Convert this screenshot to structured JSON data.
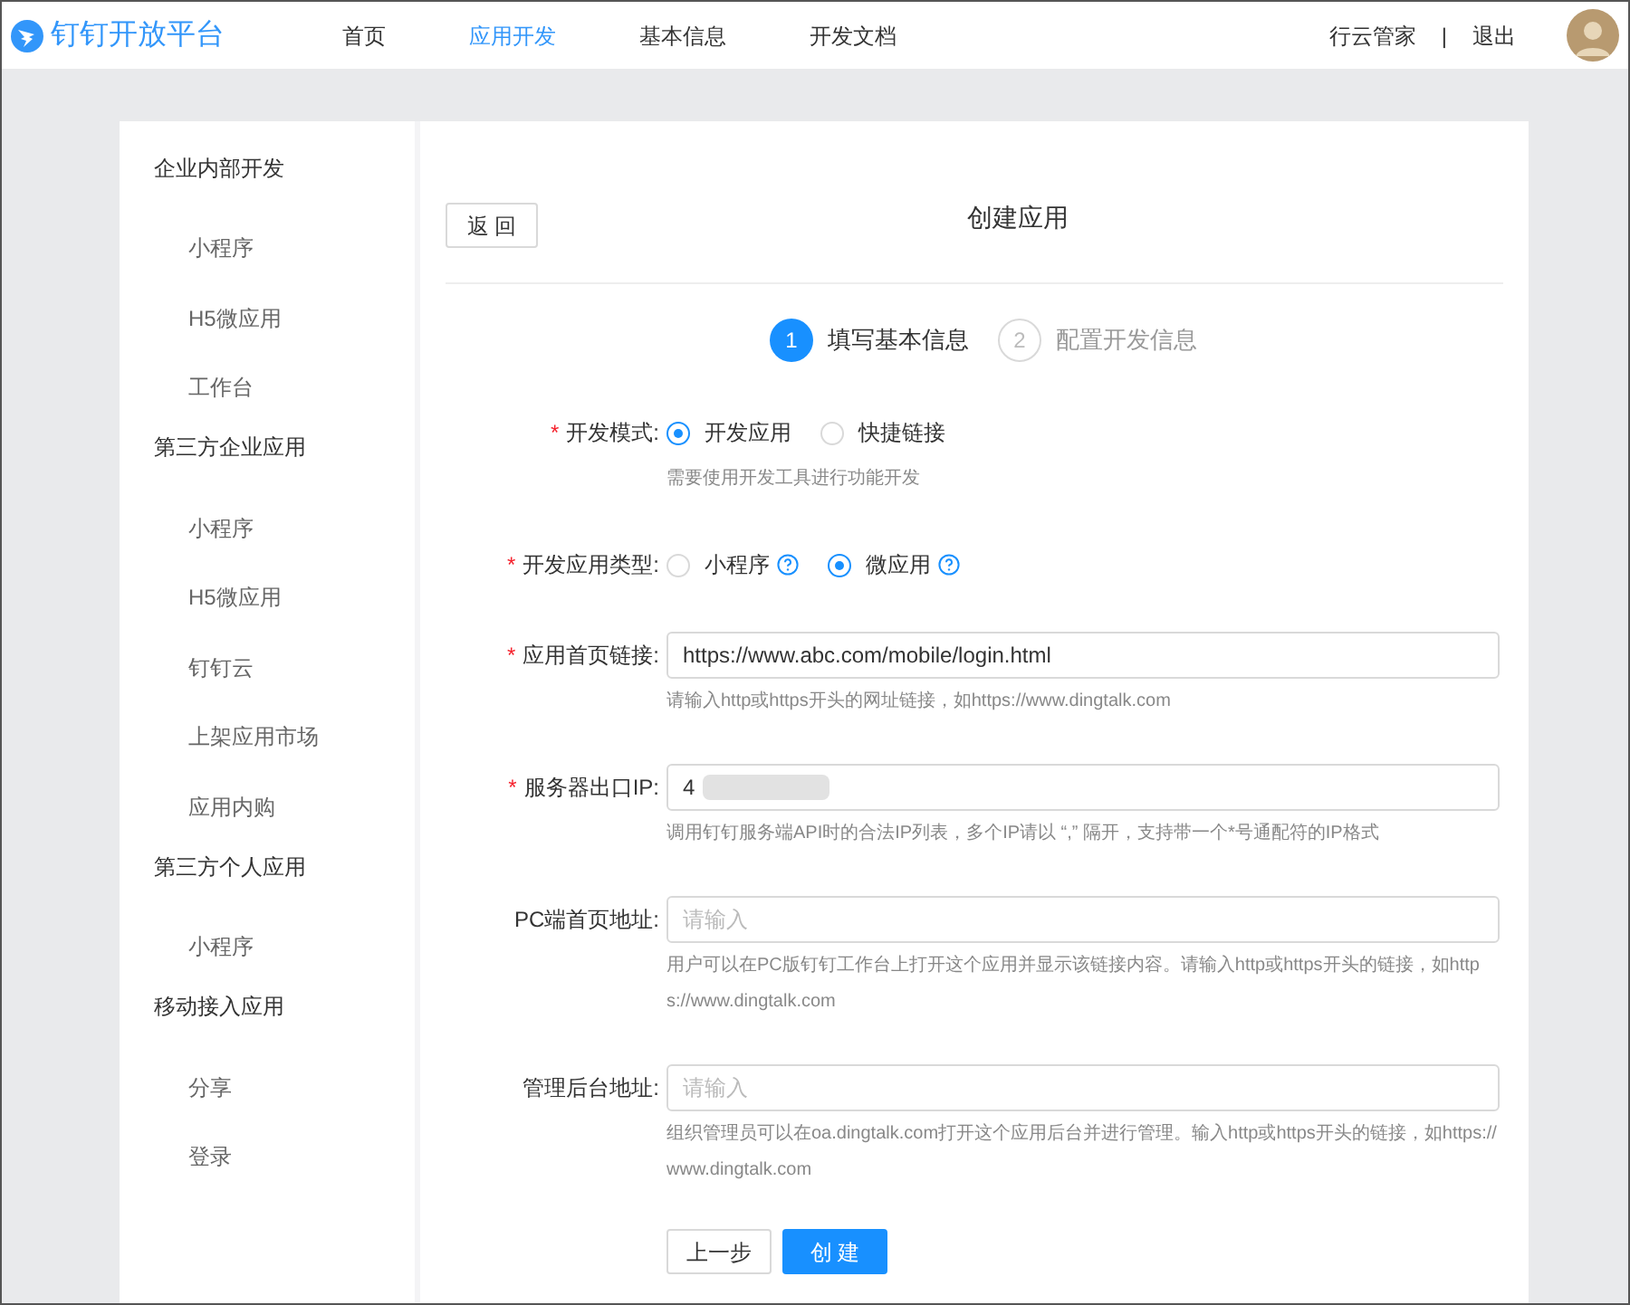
{
  "header": {
    "logo": "钉钉开放平台",
    "nav": [
      {
        "label": "首页",
        "selected": false
      },
      {
        "label": "应用开发",
        "selected": true
      },
      {
        "label": "基本信息",
        "selected": false
      },
      {
        "label": "开发文档",
        "selected": false
      }
    ],
    "user": "行云管家",
    "separator": "|",
    "logout": "退出"
  },
  "sidebar": {
    "groups": [
      {
        "title": "企业内部开发",
        "items": [
          {
            "label": "小程序"
          },
          {
            "label": "H5微应用"
          },
          {
            "label": "工作台"
          }
        ]
      },
      {
        "title": "第三方企业应用",
        "items": [
          {
            "label": "小程序"
          },
          {
            "label": "H5微应用"
          },
          {
            "label": "钉钉云"
          },
          {
            "label": "上架应用市场"
          },
          {
            "label": "应用内购"
          }
        ]
      },
      {
        "title": "第三方个人应用",
        "items": [
          {
            "label": "小程序"
          }
        ]
      },
      {
        "title": "移动接入应用",
        "items": [
          {
            "label": "分享"
          },
          {
            "label": "登录"
          }
        ]
      }
    ]
  },
  "main": {
    "back_button": "返 回",
    "title": "创建应用",
    "steps": [
      {
        "number": "1",
        "label": "填写基本信息",
        "selected": true
      },
      {
        "number": "2",
        "label": "配置开发信息",
        "selected": false
      }
    ],
    "fields": [
      {
        "kind": "radio",
        "label": "开发模式:",
        "required_mark": "*",
        "options": [
          {
            "label": "开发应用",
            "selected": true,
            "help": false
          },
          {
            "label": "快捷链接",
            "selected": false,
            "help": false
          }
        ],
        "hint": "需要使用开发工具进行功能开发"
      },
      {
        "kind": "radio",
        "label": "开发应用类型:",
        "required_mark": "*",
        "options": [
          {
            "label": "小程序",
            "selected": false,
            "help": true
          },
          {
            "label": "微应用",
            "selected": true,
            "help": true
          }
        ]
      },
      {
        "kind": "input",
        "label": "应用首页链接:",
        "required_mark": "*",
        "value": "https://www.abc.com/mobile/login.html",
        "hint": "请输入http或https开头的网址链接，如https://www.dingtalk.com"
      },
      {
        "kind": "input",
        "label": "服务器出口IP:",
        "required_mark": "*",
        "value": "4",
        "redacted": true,
        "hint": "调用钉钉服务端API时的合法IP列表，多个IP请以 “,” 隔开，支持带一个*号通配符的IP格式"
      },
      {
        "kind": "input",
        "label": "PC端首页地址:",
        "placeholder": "请输入",
        "hint": "用户可以在PC版钉钉工作台上打开这个应用并显示该链接内容。请输入http或https开头的链接，如https://www.dingtalk.com"
      },
      {
        "kind": "input",
        "label": "管理后台地址:",
        "placeholder": "请输入",
        "hint": "组织管理员可以在oa.dingtalk.com打开这个应用后台并进行管理。输入http或https开头的链接，如https://www.dingtalk.com"
      }
    ],
    "buttons": [
      {
        "kind": "secondary",
        "label": "上一步"
      },
      {
        "kind": "primary",
        "label": "创 建"
      }
    ]
  }
}
